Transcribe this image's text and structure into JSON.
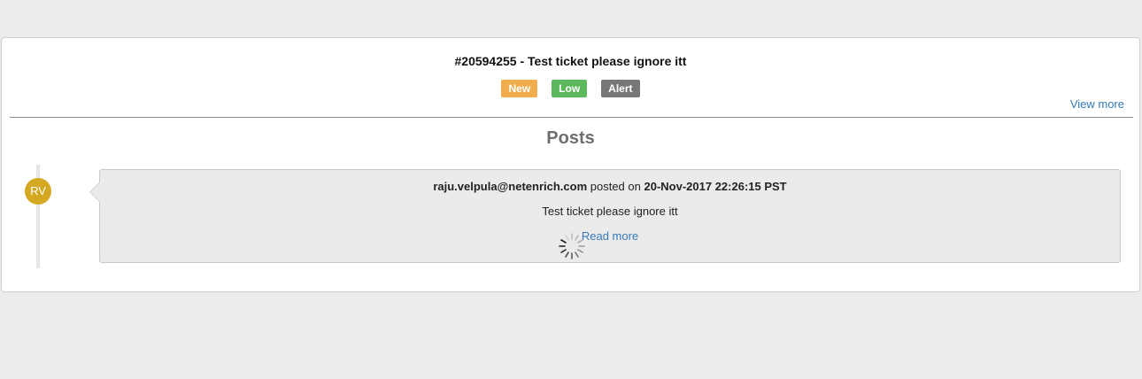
{
  "ticket": {
    "title": "#20594255 -  Test ticket please ignore itt",
    "badges": {
      "status": "New",
      "priority": "Low",
      "type": "Alert"
    },
    "view_more_label": "View more"
  },
  "posts": {
    "heading": "Posts",
    "items": [
      {
        "avatar_initials": "RV",
        "author": "raju.velpula@netenrich.com",
        "posted_on_label": "posted on",
        "date": "20-Nov-2017 22:26:15 PST",
        "body": "Test ticket please ignore itt",
        "read_more_label": "Read more"
      }
    ]
  },
  "colors": {
    "status_badge": "#f0ad4e",
    "priority_badge": "#5cb85c",
    "type_badge": "#777777",
    "avatar": "#d4a820",
    "link": "#337ab7"
  },
  "icons": {
    "loading": "loading-spinner-icon"
  }
}
